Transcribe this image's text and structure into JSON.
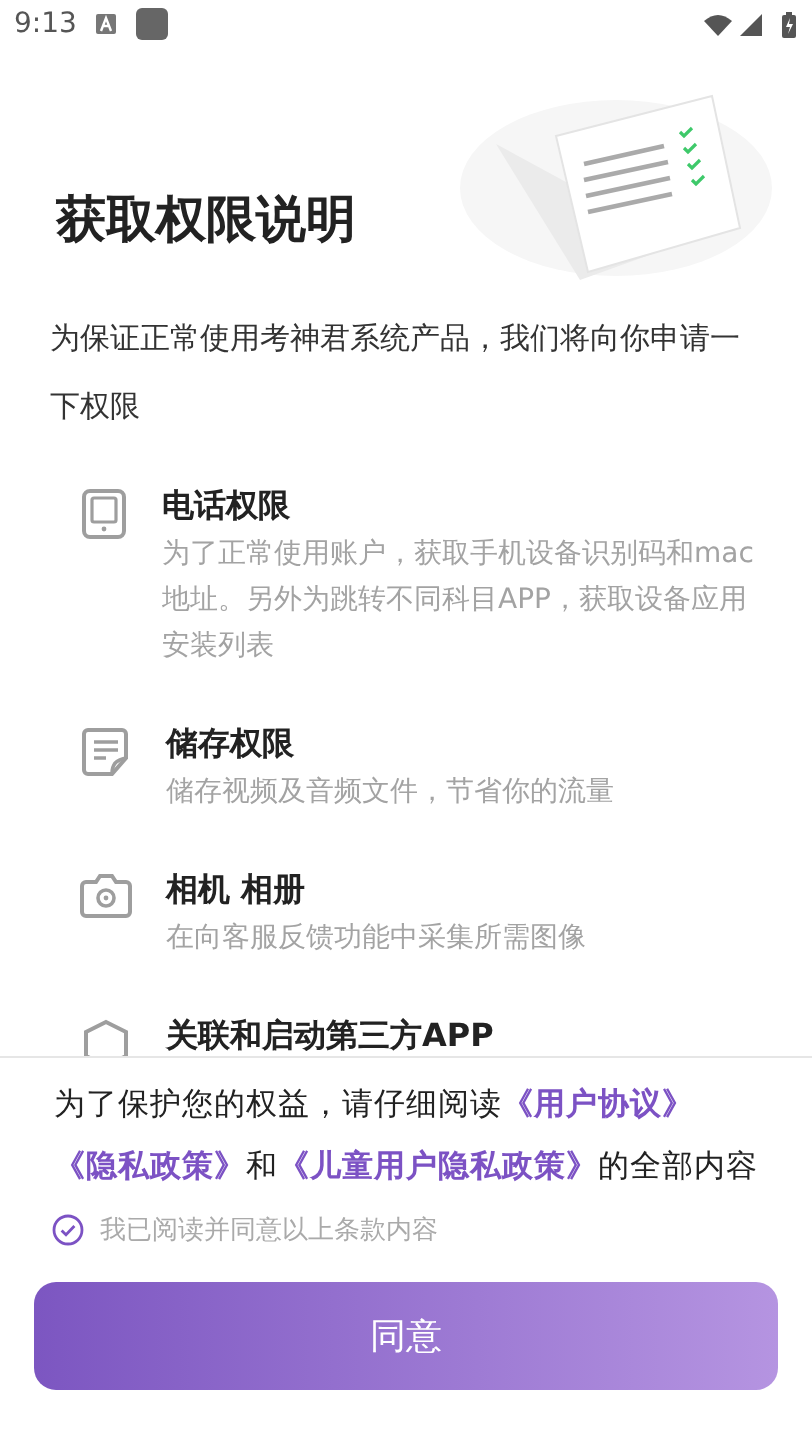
{
  "status_bar": {
    "time": "9:13"
  },
  "title": "获取权限说明",
  "intro": "为保证正常使用考神君系统产品，我们将向你申请一下权限",
  "permissions": [
    {
      "kind": "phone",
      "title": "电话权限",
      "description": "为了正常使用账户，获取手机设备识别码和mac地址。另外为跳转不同科目APP，获取设备应用安装列表"
    },
    {
      "kind": "storage",
      "title": "储存权限",
      "description": "储存视频及音频文件，节省你的流量"
    },
    {
      "kind": "camera",
      "title": "相机 相册",
      "description": "在向客服反馈功能中采集所需图像"
    },
    {
      "kind": "app",
      "title": "关联和启动第三方APP"
    }
  ],
  "agreement": {
    "segments": [
      {
        "kind": "plain",
        "text": "为了保护您的权益，请仔细阅读"
      },
      {
        "kind": "link",
        "text": "《用户协议》"
      },
      {
        "kind": "link",
        "text": "《隐私政策》"
      },
      {
        "kind": "plain",
        "text": "和"
      },
      {
        "kind": "link",
        "text": "《儿童用户隐私政策》"
      },
      {
        "kind": "plain",
        "text": "的全部内容"
      }
    ],
    "consent": {
      "label": "我已阅读并同意以上条款内容",
      "checked": true
    },
    "button": "同意"
  }
}
